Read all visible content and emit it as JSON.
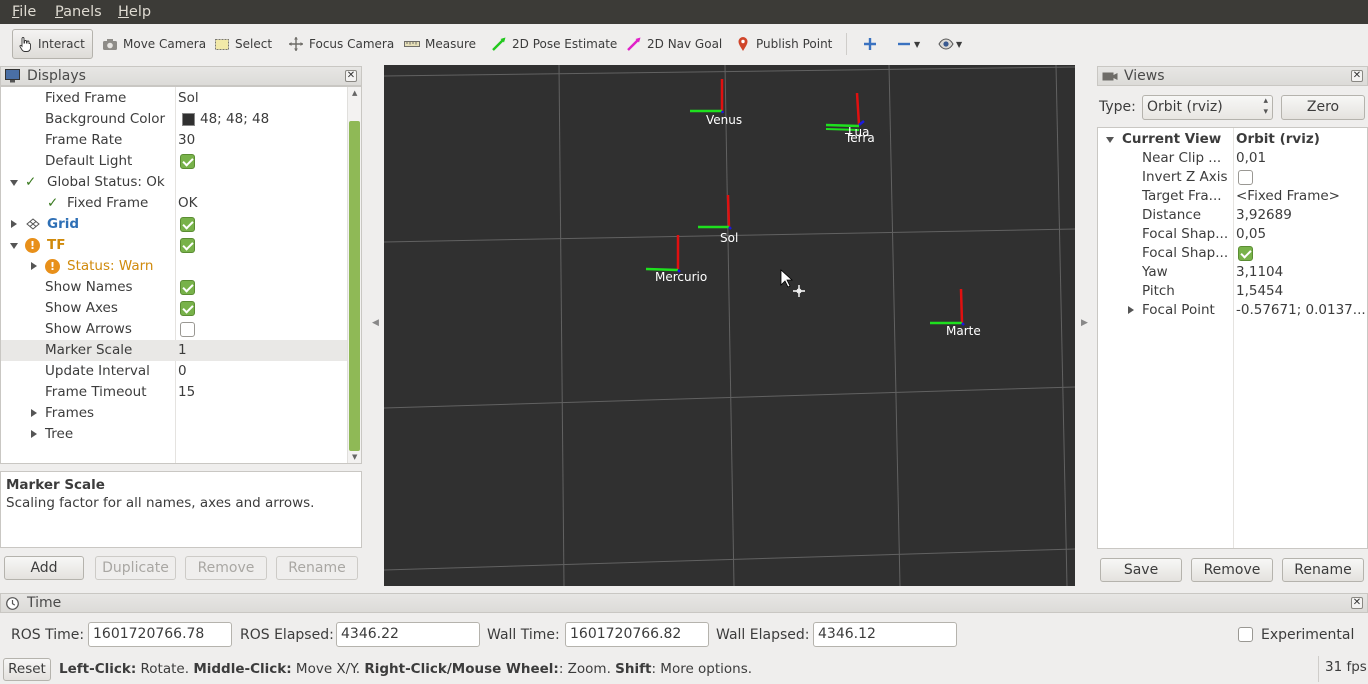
{
  "menu": [
    "File",
    "Panels",
    "Help"
  ],
  "toolbar": {
    "interact": "Interact",
    "move_camera": "Move Camera",
    "select": "Select",
    "focus_camera": "Focus Camera",
    "measure": "Measure",
    "pose_estimate": "2D Pose Estimate",
    "nav_goal": "2D Nav Goal",
    "publish_point": "Publish Point"
  },
  "displays": {
    "title": "Displays",
    "rows": [
      {
        "key": "Fixed Frame",
        "value": "Sol"
      },
      {
        "key": "Background Color",
        "value": "48; 48; 48"
      },
      {
        "key": "Frame Rate",
        "value": "30"
      },
      {
        "key": "Default Light",
        "value": ""
      },
      {
        "key": "Global Status: Ok",
        "value": ""
      },
      {
        "key": "Fixed Frame",
        "value": "OK"
      },
      {
        "key": "Grid",
        "value": ""
      },
      {
        "key": "TF",
        "value": ""
      },
      {
        "key": "Status: Warn",
        "value": ""
      },
      {
        "key": "Show Names",
        "value": ""
      },
      {
        "key": "Show Axes",
        "value": ""
      },
      {
        "key": "Show Arrows",
        "value": ""
      },
      {
        "key": "Marker Scale",
        "value": "1"
      },
      {
        "key": "Update Interval",
        "value": "0"
      },
      {
        "key": "Frame Timeout",
        "value": "15"
      },
      {
        "key": "Frames",
        "value": ""
      },
      {
        "key": "Tree",
        "value": ""
      }
    ],
    "checks": {
      "default_light": true,
      "grid": true,
      "tf": true,
      "show_names": true,
      "show_axes": true,
      "show_arrows": false
    },
    "description_title": "Marker Scale",
    "description_text": "Scaling factor for all names, axes and arrows.",
    "buttons": [
      "Add",
      "Duplicate",
      "Remove",
      "Rename"
    ]
  },
  "viewport": {
    "background": "#303030",
    "frames": [
      "Venus",
      "Lua",
      "Terra",
      "Sol",
      "Mercurio",
      "Marte"
    ]
  },
  "views": {
    "title": "Views",
    "type_label": "Type:",
    "type_value": "Orbit (rviz)",
    "zero": "Zero",
    "rows": [
      {
        "key": "Current View",
        "value": "Orbit (rviz)"
      },
      {
        "key": "Near Clip ...",
        "value": "0,01"
      },
      {
        "key": "Invert Z Axis",
        "value": ""
      },
      {
        "key": "Target Fra...",
        "value": "<Fixed Frame>"
      },
      {
        "key": "Distance",
        "value": "3,92689"
      },
      {
        "key": "Focal Shap...",
        "value": "0,05"
      },
      {
        "key": "Focal Shap...",
        "value": ""
      },
      {
        "key": "Yaw",
        "value": "3,1104"
      },
      {
        "key": "Pitch",
        "value": "1,5454"
      },
      {
        "key": "Focal Point",
        "value": "-0.57671; 0.0137..."
      }
    ],
    "buttons": [
      "Save",
      "Remove",
      "Rename"
    ]
  },
  "time": {
    "title": "Time",
    "ros_time_label": "ROS Time:",
    "ros_time": "1601720766.78",
    "ros_elapsed_label": "ROS Elapsed:",
    "ros_elapsed": "4346.22",
    "wall_time_label": "Wall Time:",
    "wall_time": "1601720766.82",
    "wall_elapsed_label": "Wall Elapsed:",
    "wall_elapsed": "4346.12",
    "experimental": "Experimental"
  },
  "status": {
    "reset": "Reset",
    "left_click": "Left-Click:",
    "left_desc": " Rotate. ",
    "middle_click": "Middle-Click:",
    "middle_desc": " Move X/Y. ",
    "right_click": "Right-Click/Mouse Wheel:",
    "right_desc": ": Zoom. ",
    "shift": "Shift",
    "shift_desc": ": More options.",
    "fps": "31 fps"
  },
  "colors": {
    "accent_green": "#78b24a",
    "warn": "#d08a0b",
    "link_blue": "#2e6fb5"
  }
}
